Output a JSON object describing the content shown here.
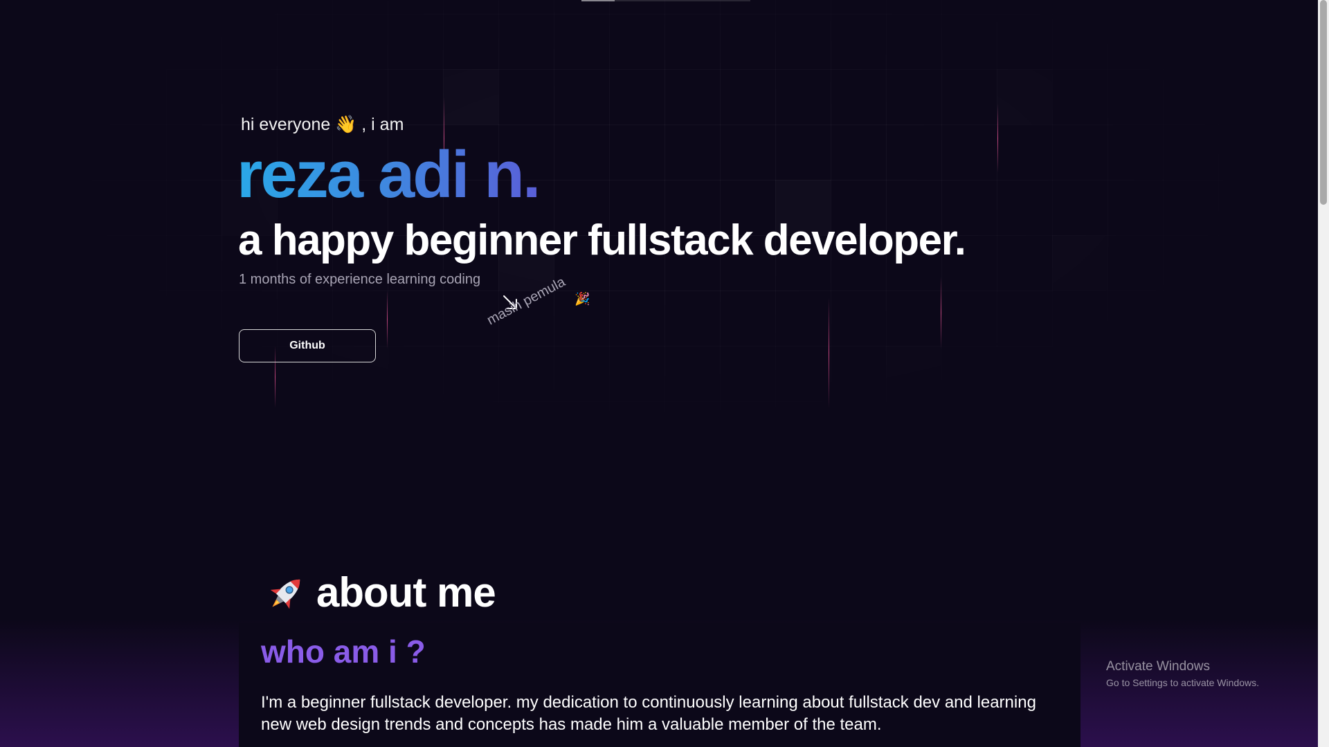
{
  "hero": {
    "greeting": "hi everyone 👋 , i am",
    "name": "reza adi n.",
    "role": "a happy beginner fullstack developer.",
    "experience": "1 months of experience learning coding",
    "github_label": "Github",
    "badge_note": "masih pemula",
    "badge_note_icon": "party-popper-icon"
  },
  "about": {
    "title": "about me",
    "title_icon": "rocket-icon",
    "subtitle": "who am i ?",
    "body": "I'm a beginner fullstack developer. my dedication to continuously learning about fullstack dev and learning new web design trends and concepts has made him a valuable member of the team."
  },
  "watermark": {
    "title": "Activate Windows",
    "subtitle": "Go to Settings to activate Windows."
  },
  "colors": {
    "background": "#0c0819",
    "name_gradient_start": "#2aa8e8",
    "name_gradient_end": "#5a5fd8",
    "subtitle_accent": "#8a5ce8",
    "muted_text": "#a8a4b4",
    "beam": "#ff5aa0"
  }
}
